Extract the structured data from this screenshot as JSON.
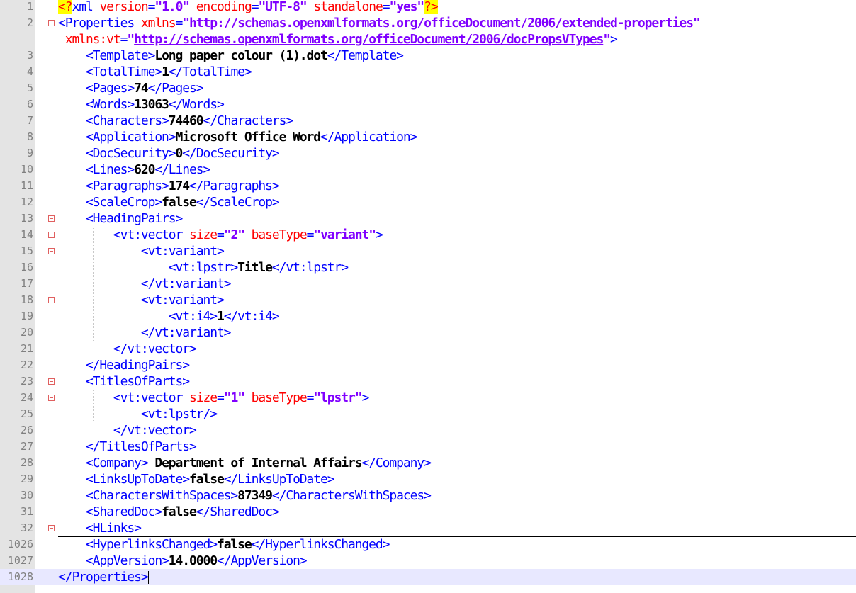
{
  "editor": {
    "current_line": "1028",
    "lines": [
      {
        "n": "1",
        "parts": [
          {
            "c": "pi",
            "t": "<?"
          },
          {
            "c": "tag",
            "t": "xml "
          },
          {
            "c": "attr",
            "t": "version"
          },
          {
            "c": "tag",
            "t": "="
          },
          {
            "c": "val",
            "t": "\"1.0\""
          },
          {
            "c": "attr",
            "t": " encoding"
          },
          {
            "c": "tag",
            "t": "="
          },
          {
            "c": "val",
            "t": "\"UTF-8\""
          },
          {
            "c": "attr",
            "t": " standalone"
          },
          {
            "c": "tag",
            "t": "="
          },
          {
            "c": "val",
            "t": "\"yes\""
          },
          {
            "c": "pi",
            "t": "?>"
          }
        ]
      },
      {
        "n": "2",
        "parts": [
          {
            "c": "tag",
            "t": "<Properties "
          },
          {
            "c": "attr",
            "t": "xmlns"
          },
          {
            "c": "tag",
            "t": "="
          },
          {
            "c": "val",
            "t": "\""
          },
          {
            "c": "url",
            "t": "http://schemas.openxmlformats.org/officeDocument/2006/extended-properties"
          },
          {
            "c": "val",
            "t": "\""
          }
        ]
      },
      {
        "n": "",
        "parts": [
          {
            "c": "attr",
            "t": " xmlns:vt"
          },
          {
            "c": "tag",
            "t": "="
          },
          {
            "c": "val",
            "t": "\""
          },
          {
            "c": "url",
            "t": "http://schemas.openxmlformats.org/officeDocument/2006/docPropsVTypes"
          },
          {
            "c": "val",
            "t": "\""
          },
          {
            "c": "tag",
            "t": ">"
          }
        ]
      },
      {
        "n": "3",
        "parts": [
          {
            "c": "tag",
            "t": "    <Template>"
          },
          {
            "c": "txt",
            "t": "Long paper colour (1).dot"
          },
          {
            "c": "tag",
            "t": "</Template>"
          }
        ]
      },
      {
        "n": "4",
        "parts": [
          {
            "c": "tag",
            "t": "    <TotalTime>"
          },
          {
            "c": "txt",
            "t": "1"
          },
          {
            "c": "tag",
            "t": "</TotalTime>"
          }
        ]
      },
      {
        "n": "5",
        "parts": [
          {
            "c": "tag",
            "t": "    <Pages>"
          },
          {
            "c": "txt",
            "t": "74"
          },
          {
            "c": "tag",
            "t": "</Pages>"
          }
        ]
      },
      {
        "n": "6",
        "parts": [
          {
            "c": "tag",
            "t": "    <Words>"
          },
          {
            "c": "txt",
            "t": "13063"
          },
          {
            "c": "tag",
            "t": "</Words>"
          }
        ]
      },
      {
        "n": "7",
        "parts": [
          {
            "c": "tag",
            "t": "    <Characters>"
          },
          {
            "c": "txt",
            "t": "74460"
          },
          {
            "c": "tag",
            "t": "</Characters>"
          }
        ]
      },
      {
        "n": "8",
        "parts": [
          {
            "c": "tag",
            "t": "    <Application>"
          },
          {
            "c": "txt",
            "t": "Microsoft Office Word"
          },
          {
            "c": "tag",
            "t": "</Application>"
          }
        ]
      },
      {
        "n": "9",
        "parts": [
          {
            "c": "tag",
            "t": "    <DocSecurity>"
          },
          {
            "c": "txt",
            "t": "0"
          },
          {
            "c": "tag",
            "t": "</DocSecurity>"
          }
        ]
      },
      {
        "n": "10",
        "parts": [
          {
            "c": "tag",
            "t": "    <Lines>"
          },
          {
            "c": "txt",
            "t": "620"
          },
          {
            "c": "tag",
            "t": "</Lines>"
          }
        ]
      },
      {
        "n": "11",
        "parts": [
          {
            "c": "tag",
            "t": "    <Paragraphs>"
          },
          {
            "c": "txt",
            "t": "174"
          },
          {
            "c": "tag",
            "t": "</Paragraphs>"
          }
        ]
      },
      {
        "n": "12",
        "parts": [
          {
            "c": "tag",
            "t": "    <ScaleCrop>"
          },
          {
            "c": "txt",
            "t": "false"
          },
          {
            "c": "tag",
            "t": "</ScaleCrop>"
          }
        ]
      },
      {
        "n": "13",
        "parts": [
          {
            "c": "tag",
            "t": "    <HeadingPairs>"
          }
        ]
      },
      {
        "n": "14",
        "parts": [
          {
            "c": "tag",
            "t": "        <vt:vector "
          },
          {
            "c": "attr",
            "t": "size"
          },
          {
            "c": "tag",
            "t": "="
          },
          {
            "c": "val",
            "t": "\"2\""
          },
          {
            "c": "attr",
            "t": " baseType"
          },
          {
            "c": "tag",
            "t": "="
          },
          {
            "c": "val",
            "t": "\"variant\""
          },
          {
            "c": "tag",
            "t": ">"
          }
        ]
      },
      {
        "n": "15",
        "parts": [
          {
            "c": "tag",
            "t": "            <vt:variant>"
          }
        ]
      },
      {
        "n": "16",
        "parts": [
          {
            "c": "tag",
            "t": "                <vt:lpstr>"
          },
          {
            "c": "txt",
            "t": "Title"
          },
          {
            "c": "tag",
            "t": "</vt:lpstr>"
          }
        ]
      },
      {
        "n": "17",
        "parts": [
          {
            "c": "tag",
            "t": "            </vt:variant>"
          }
        ]
      },
      {
        "n": "18",
        "parts": [
          {
            "c": "tag",
            "t": "            <vt:variant>"
          }
        ]
      },
      {
        "n": "19",
        "parts": [
          {
            "c": "tag",
            "t": "                <vt:i4>"
          },
          {
            "c": "txt",
            "t": "1"
          },
          {
            "c": "tag",
            "t": "</vt:i4>"
          }
        ]
      },
      {
        "n": "20",
        "parts": [
          {
            "c": "tag",
            "t": "            </vt:variant>"
          }
        ]
      },
      {
        "n": "21",
        "parts": [
          {
            "c": "tag",
            "t": "        </vt:vector>"
          }
        ]
      },
      {
        "n": "22",
        "parts": [
          {
            "c": "tag",
            "t": "    </HeadingPairs>"
          }
        ]
      },
      {
        "n": "23",
        "parts": [
          {
            "c": "tag",
            "t": "    <TitlesOfParts>"
          }
        ]
      },
      {
        "n": "24",
        "parts": [
          {
            "c": "tag",
            "t": "        <vt:vector "
          },
          {
            "c": "attr",
            "t": "size"
          },
          {
            "c": "tag",
            "t": "="
          },
          {
            "c": "val",
            "t": "\"1\""
          },
          {
            "c": "attr",
            "t": " baseType"
          },
          {
            "c": "tag",
            "t": "="
          },
          {
            "c": "val",
            "t": "\"lpstr\""
          },
          {
            "c": "tag",
            "t": ">"
          }
        ]
      },
      {
        "n": "25",
        "parts": [
          {
            "c": "tag",
            "t": "            <vt:lpstr/>"
          }
        ]
      },
      {
        "n": "26",
        "parts": [
          {
            "c": "tag",
            "t": "        </vt:vector>"
          }
        ]
      },
      {
        "n": "27",
        "parts": [
          {
            "c": "tag",
            "t": "    </TitlesOfParts>"
          }
        ]
      },
      {
        "n": "28",
        "parts": [
          {
            "c": "tag",
            "t": "    <Company>"
          },
          {
            "c": "txt",
            "t": " Department of Internal Affairs"
          },
          {
            "c": "tag",
            "t": "</Company>"
          }
        ]
      },
      {
        "n": "29",
        "parts": [
          {
            "c": "tag",
            "t": "    <LinksUpToDate>"
          },
          {
            "c": "txt",
            "t": "false"
          },
          {
            "c": "tag",
            "t": "</LinksUpToDate>"
          }
        ]
      },
      {
        "n": "30",
        "parts": [
          {
            "c": "tag",
            "t": "    <CharactersWithSpaces>"
          },
          {
            "c": "txt",
            "t": "87349"
          },
          {
            "c": "tag",
            "t": "</CharactersWithSpaces>"
          }
        ]
      },
      {
        "n": "31",
        "parts": [
          {
            "c": "tag",
            "t": "    <SharedDoc>"
          },
          {
            "c": "txt",
            "t": "false"
          },
          {
            "c": "tag",
            "t": "</SharedDoc>"
          }
        ]
      },
      {
        "n": "32",
        "parts": [
          {
            "c": "tag",
            "t": "    <HLinks>"
          }
        ]
      },
      {
        "n": "1026",
        "parts": [
          {
            "c": "tag",
            "t": "    <HyperlinksChanged>"
          },
          {
            "c": "txt",
            "t": "false"
          },
          {
            "c": "tag",
            "t": "</HyperlinksChanged>"
          }
        ]
      },
      {
        "n": "1027",
        "parts": [
          {
            "c": "tag",
            "t": "    <AppVersion>"
          },
          {
            "c": "txt",
            "t": "14.0000"
          },
          {
            "c": "tag",
            "t": "</AppVersion>"
          }
        ]
      },
      {
        "n": "1028",
        "parts": [
          {
            "c": "tag",
            "t": "</Properties>"
          }
        ]
      }
    ],
    "fold_markers": [
      "2",
      "13",
      "14",
      "15",
      "18",
      "23",
      "24",
      "32"
    ]
  }
}
